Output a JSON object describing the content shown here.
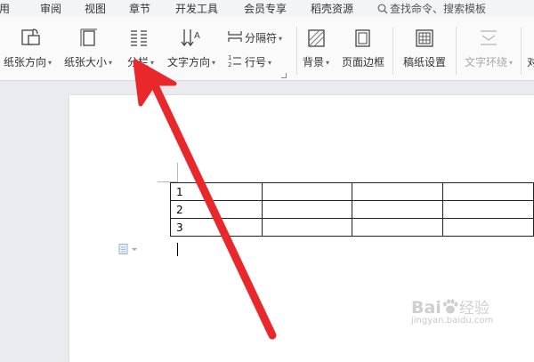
{
  "menu": {
    "items": [
      {
        "key": "references",
        "label": "引用"
      },
      {
        "key": "review",
        "label": "审阅"
      },
      {
        "key": "view",
        "label": "视图"
      },
      {
        "key": "section",
        "label": "章节"
      },
      {
        "key": "developer",
        "label": "开发工具"
      },
      {
        "key": "member",
        "label": "会员专享"
      },
      {
        "key": "resources",
        "label": "稻壳资源"
      }
    ],
    "search_label": "查找命令、搜索模板"
  },
  "ribbon": {
    "orientation_label": "纸张方向",
    "size_label": "纸张大小",
    "columns_label": "分栏",
    "text_direction_label": "文字方向",
    "separator_label": "分隔符",
    "line_number_label": "行号",
    "background_label": "背景",
    "page_border_label": "页面边框",
    "manuscript_label": "稿纸设置",
    "text_wrap_label": "文字环绕",
    "align_label": "对"
  },
  "table": {
    "rows": [
      [
        "1",
        "",
        "",
        ""
      ],
      [
        "2",
        "",
        "",
        ""
      ],
      [
        "3",
        "",
        "",
        ""
      ]
    ]
  },
  "watermark": {
    "brand": "Bai",
    "brand_tail": "经验",
    "url": "jingyan.baidu.com"
  },
  "colors": {
    "arrow": "#e8282b",
    "menubar": "#f3f4f6",
    "ribbon": "#fafafa",
    "workspace": "#e9ebee"
  }
}
